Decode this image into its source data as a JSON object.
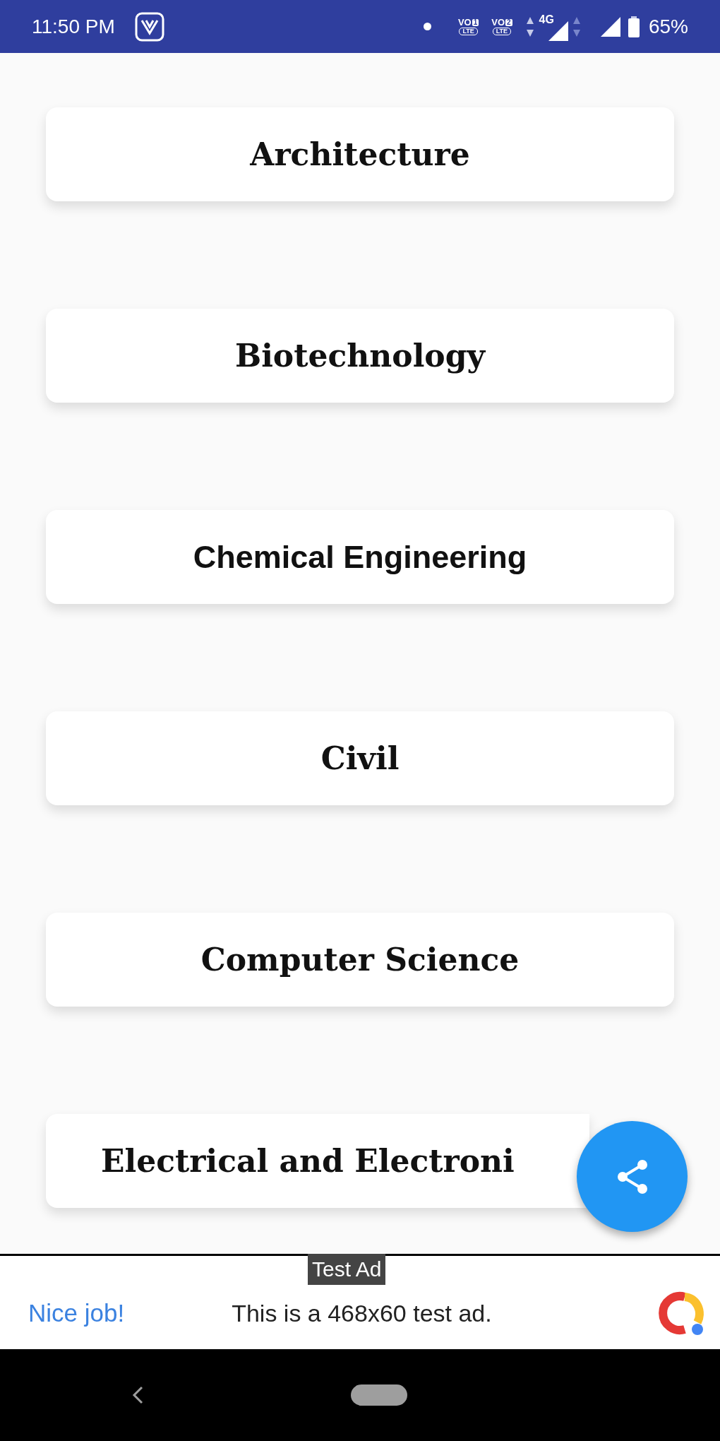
{
  "status_bar": {
    "time": "11:50 PM",
    "volte": [
      {
        "label": "VO",
        "sim": "1",
        "sub": "LTE"
      },
      {
        "label": "VO",
        "sim": "2",
        "sub": "LTE"
      }
    ],
    "network": "4G",
    "battery": "65%"
  },
  "courses": [
    {
      "label": "Architecture",
      "kind": "serif"
    },
    {
      "label": "Biotechnology",
      "kind": "serif"
    },
    {
      "label": "Chemical Engineering",
      "kind": "sans"
    },
    {
      "label": "Civil",
      "kind": "serif"
    },
    {
      "label": "Computer Science",
      "kind": "serif"
    },
    {
      "label": "Electrical and Electroni",
      "kind": "serif",
      "cut": true
    }
  ],
  "ad": {
    "badge": "Test Ad",
    "headline": "Nice job!",
    "text": "This is a 468x60 test ad."
  }
}
